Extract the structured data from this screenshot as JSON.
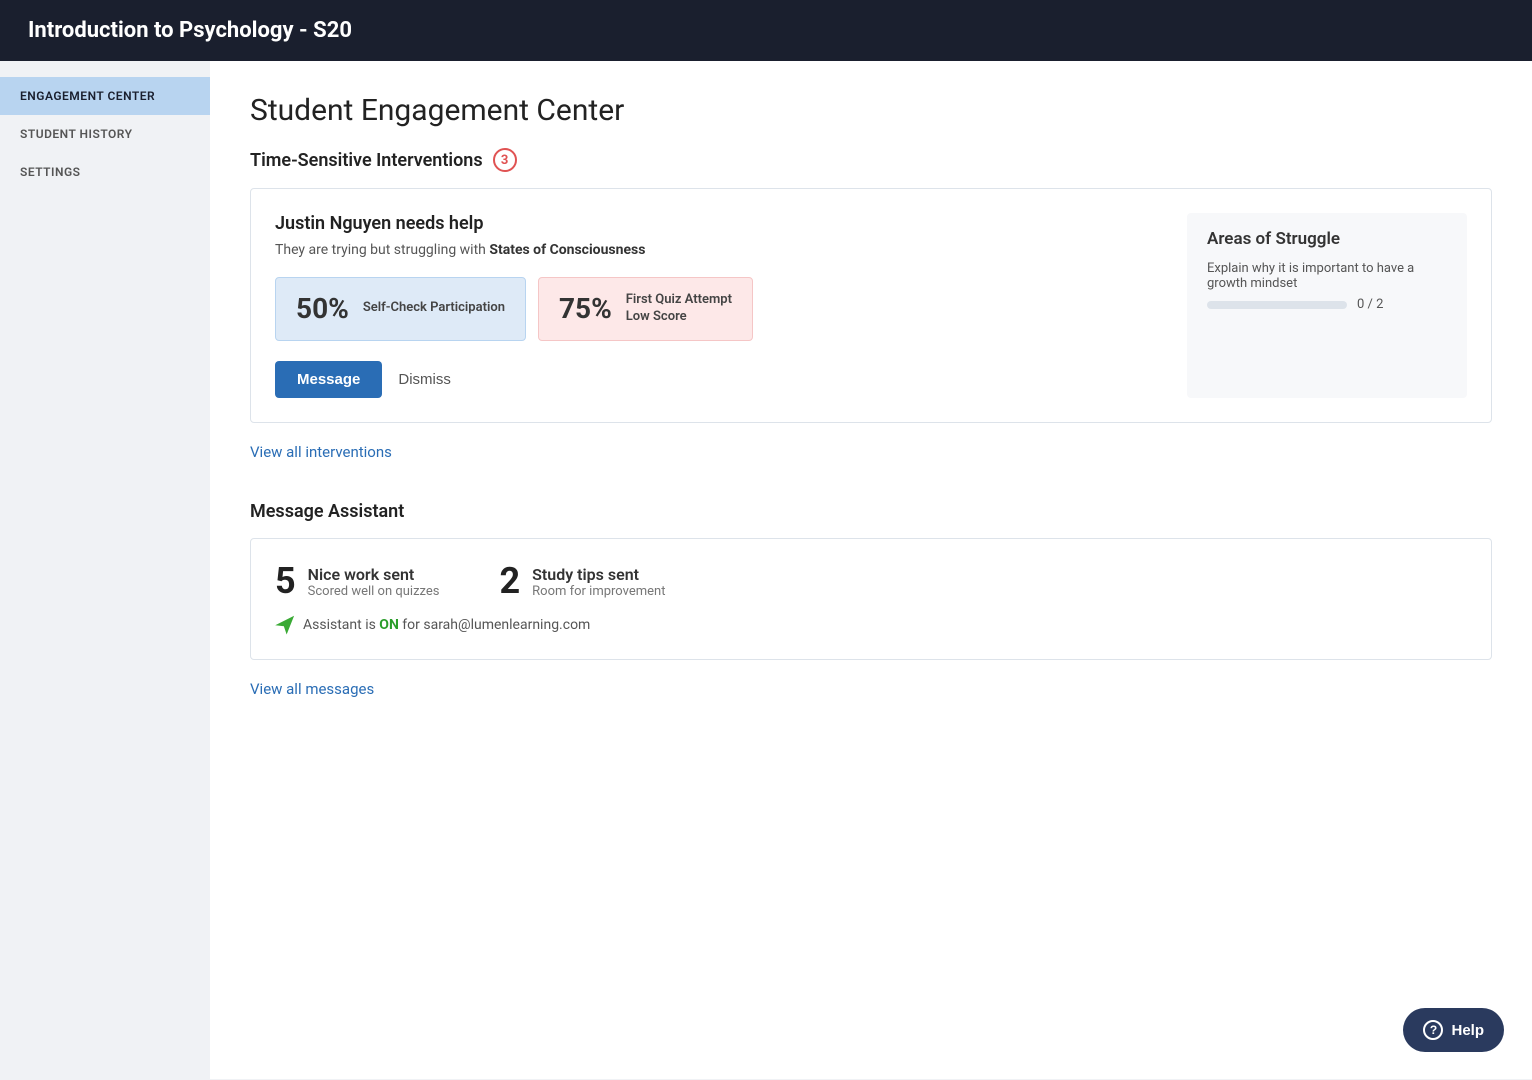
{
  "header": {
    "title": "Introduction to Psychology - S20"
  },
  "sidebar": {
    "items": [
      {
        "id": "engagement-center",
        "label": "ENGAGEMENT CENTER",
        "active": true
      },
      {
        "id": "student-history",
        "label": "STUDENT HISTORY",
        "active": false
      },
      {
        "id": "settings",
        "label": "SETTINGS",
        "active": false
      }
    ]
  },
  "main": {
    "page_title": "Student Engagement Center",
    "interventions": {
      "section_title": "Time-Sensitive Interventions",
      "badge_count": "3",
      "card": {
        "student_name": "Justin Nguyen needs help",
        "description_pre": "They are trying but struggling with ",
        "description_bold": "States of Consciousness",
        "stat_blue_percent": "50%",
        "stat_blue_label": "Self-Check Participation",
        "stat_pink_percent": "75%",
        "stat_pink_label_line1": "First Quiz Attempt",
        "stat_pink_label_line2": "Low Score",
        "btn_message": "Message",
        "btn_dismiss": "Dismiss",
        "areas_title": "Areas of Struggle",
        "area_label": "Explain why it is important to have a growth mindset",
        "progress_current": 0,
        "progress_total": 2,
        "progress_text": "0 / 2",
        "progress_width_pct": 0
      },
      "view_link": "View all interventions"
    },
    "message_assistant": {
      "section_title": "Message Assistant",
      "card": {
        "stat1_num": "5",
        "stat1_title": "Nice work sent",
        "stat1_sub": "Scored well on quizzes",
        "stat2_num": "2",
        "stat2_title": "Study tips sent",
        "stat2_sub": "Room for improvement",
        "assistant_pre": "Assistant is ",
        "assistant_status": "ON",
        "assistant_post": " for sarah@lumenlearning.com"
      },
      "view_link": "View all messages"
    }
  },
  "help_button": {
    "label": "Help"
  }
}
